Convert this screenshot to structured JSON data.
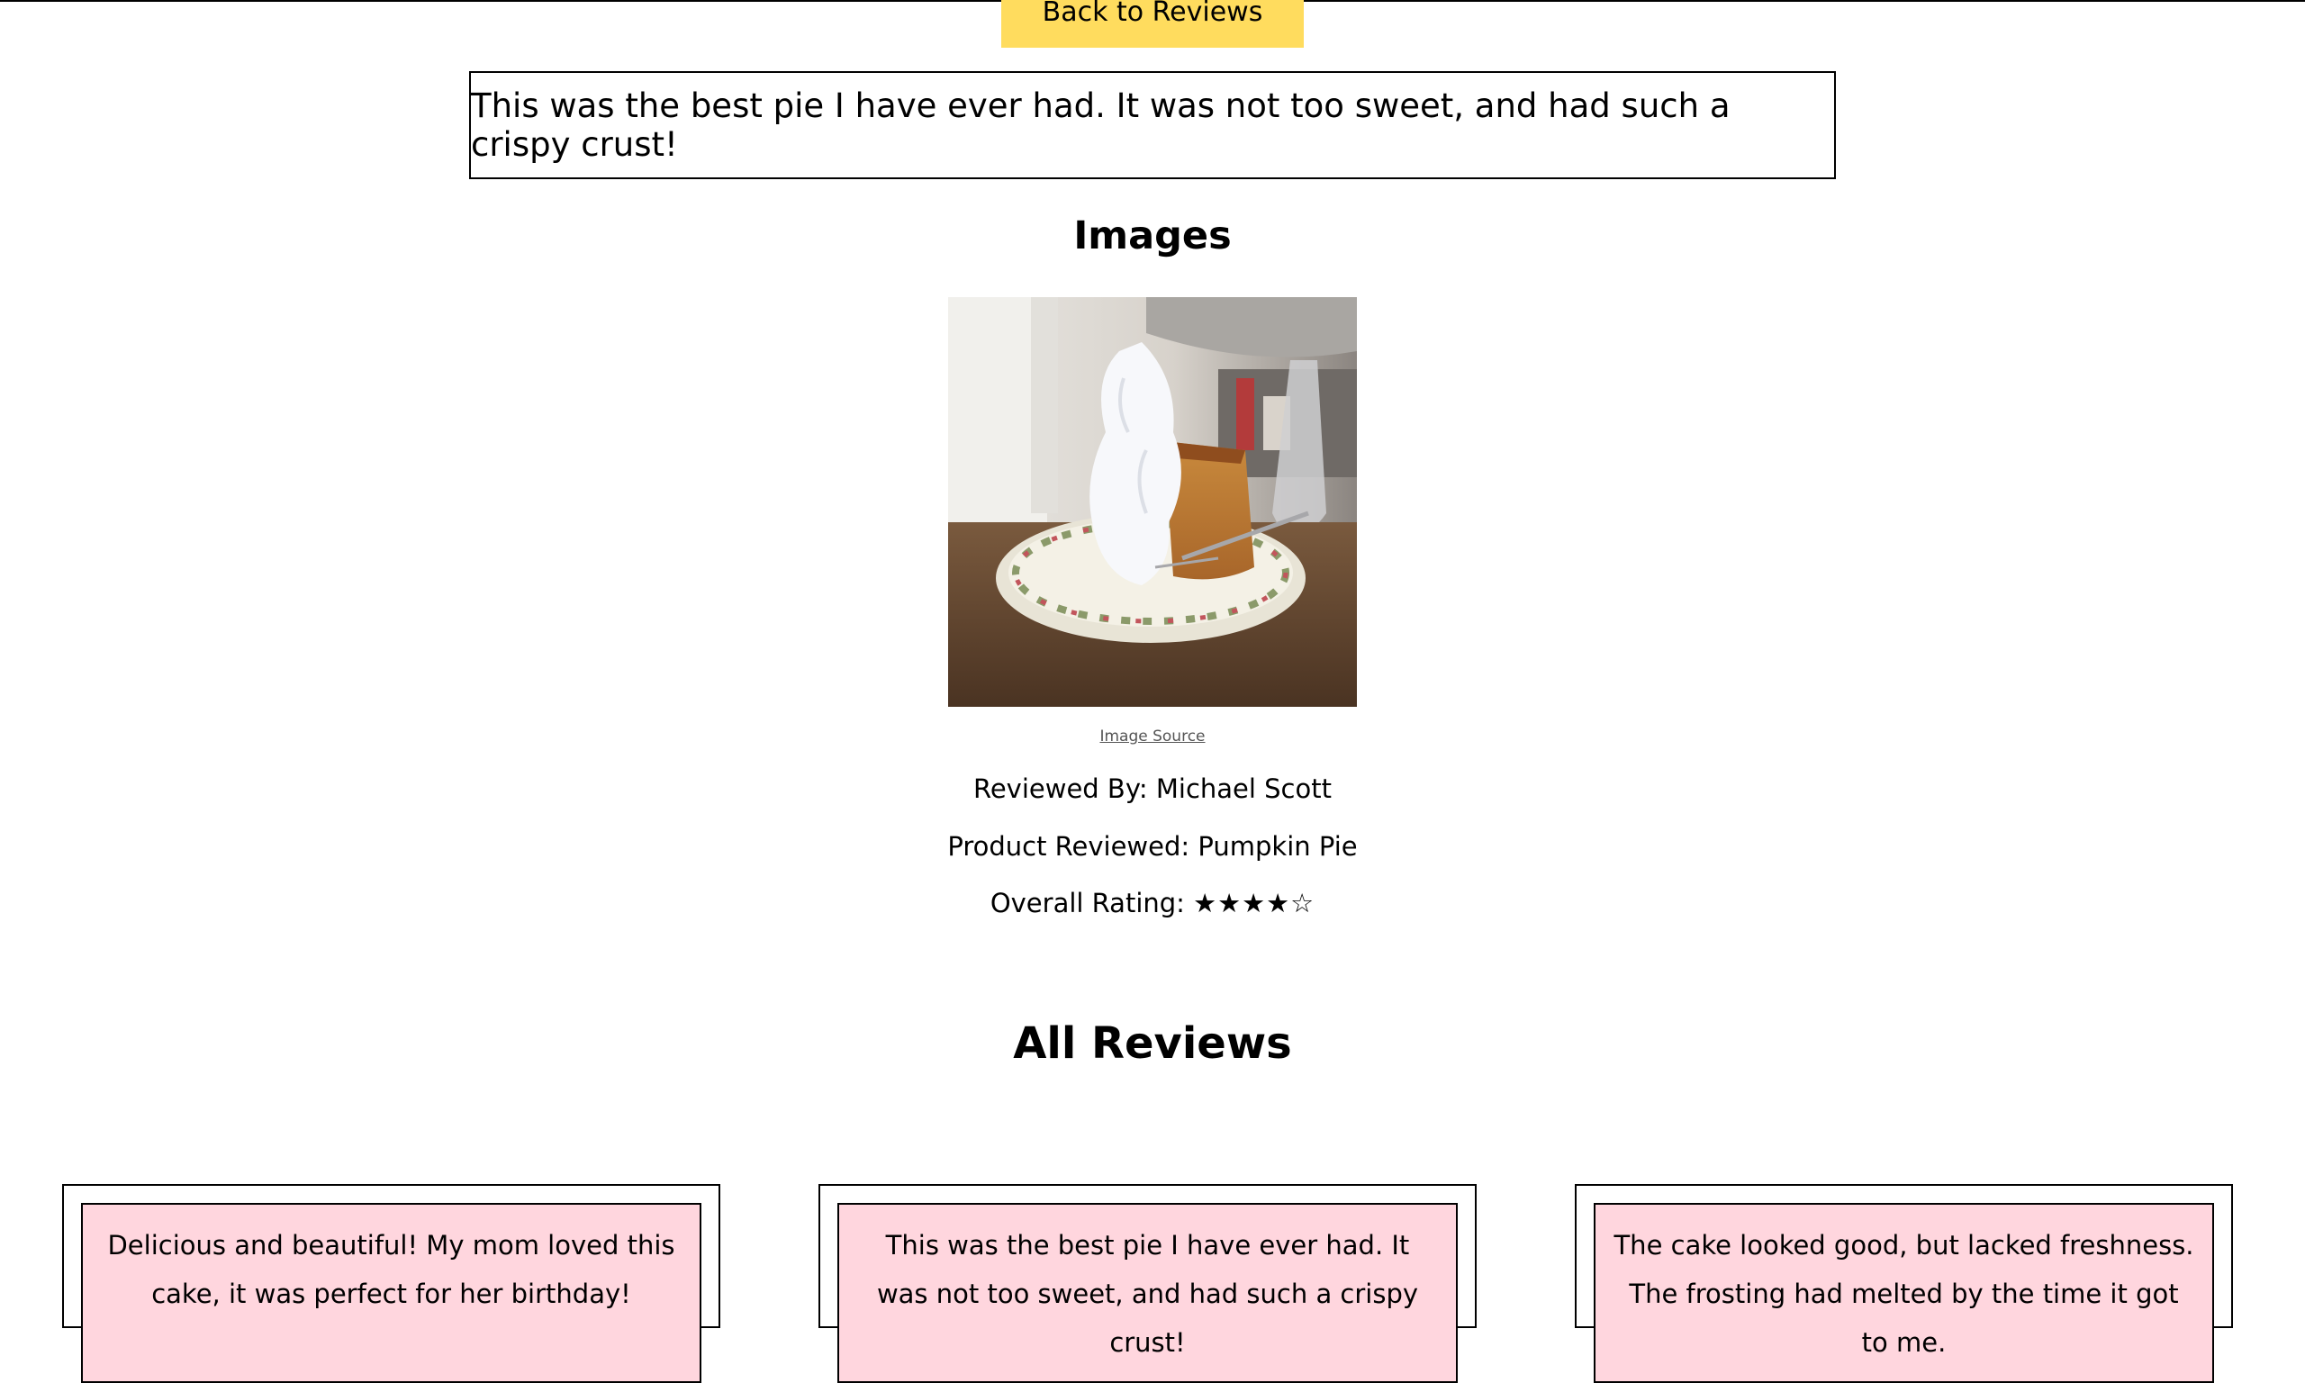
{
  "nav": {
    "back_label": "Back to Reviews"
  },
  "review": {
    "text": "This was the best pie I have ever had. It was not too sweet, and had such a crispy crust!"
  },
  "images_section": {
    "title": "Images",
    "image_alt": "Slice of pumpkin pie with whipped cream on a plate",
    "source_label": "Image Source"
  },
  "details": {
    "reviewed_by_label": "Reviewed By:",
    "reviewer": "Michael Scott",
    "product_label": "Product Reviewed:",
    "product": "Pumpkin Pie",
    "rating_label": "Overall Rating:",
    "rating_stars": "★★★★☆",
    "rating_value": 4,
    "rating_max": 5
  },
  "all_reviews": {
    "title": "All Reviews",
    "cards": [
      {
        "text": "Delicious and beautiful! My mom loved this cake, it was perfect for her birthday!"
      },
      {
        "text": "This was the best pie I have ever had. It was not too sweet, and had such a crispy crust!"
      },
      {
        "text": "The cake looked good, but lacked freshness. The frosting had melted by the time it got to me."
      }
    ]
  },
  "colors": {
    "button_bg": "#ffdc5e",
    "card_bg": "#ffd6de",
    "border": "#000000"
  }
}
